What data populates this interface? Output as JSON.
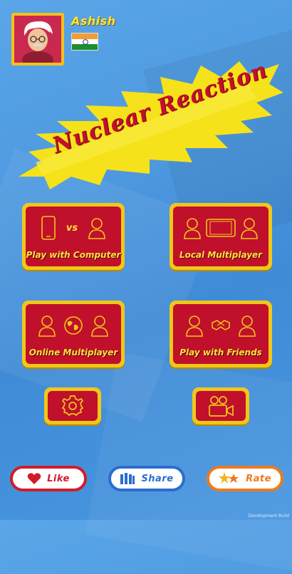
{
  "player": {
    "name": "Ashish",
    "flag": "india-flag"
  },
  "title": "Nuclear Reaction",
  "menu": {
    "play_computer": {
      "label": "Play with Computer",
      "vs": "vs"
    },
    "local_multiplayer": {
      "label": "Local Multiplayer"
    },
    "online_multiplayer": {
      "label": "Online Multiplayer"
    },
    "play_friends": {
      "label": "Play with Friends"
    }
  },
  "tools": {
    "settings_icon": "gear-icon",
    "video_icon": "video-camera-icon"
  },
  "footer": {
    "like": "Like",
    "share": "Share",
    "rate": "Rate",
    "note": "Development Build"
  },
  "colors": {
    "background": "#4d98df",
    "button_frame": "#f1c719",
    "button_fill": "#c1102b",
    "label_yellow": "#ffe23a",
    "title_red": "#c2102a",
    "like_border": "#d21b2a",
    "share_border": "#2a6dd1",
    "rate_border": "#ee7a1c"
  }
}
